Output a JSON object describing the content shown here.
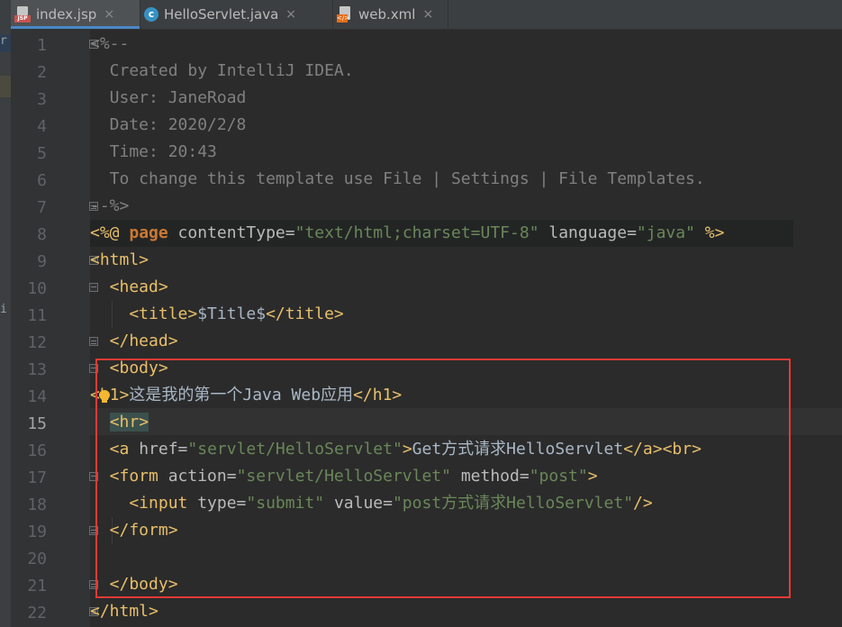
{
  "tabs": [
    {
      "label": "index.jsp",
      "icon": "jsp-file-icon",
      "active": true
    },
    {
      "label": "HelloServlet.java",
      "icon": "java-class-icon",
      "active": false
    },
    {
      "label": "web.xml",
      "icon": "xml-file-icon",
      "active": false
    }
  ],
  "tab_close_glyph": "×",
  "icon_labels": {
    "jsp": "JSP",
    "java": "c",
    "xml": "</>"
  },
  "left_panel_fragments": [
    "r",
    "i"
  ],
  "line_numbers": [
    "1",
    "2",
    "3",
    "4",
    "5",
    "6",
    "7",
    "8",
    "9",
    "10",
    "11",
    "12",
    "13",
    "14",
    "15",
    "16",
    "17",
    "18",
    "19",
    "20",
    "21",
    "22"
  ],
  "current_line": "15",
  "code": {
    "l1": "<%--",
    "l2": "  Created by IntelliJ IDEA.",
    "l3": "  User: JaneRoad",
    "l4": "  Date: 2020/2/8",
    "l5": "  Time: 20:43",
    "l6": "  To change this template use File | Settings | File Templates.",
    "l7": "--%>",
    "l8": {
      "open": "<%@ ",
      "directive": "page",
      "attr1": " contentType=",
      "val1": "\"text/html;charset=UTF-8\"",
      "attr2": " language=",
      "val2": "\"java\"",
      "close": " %>"
    },
    "l9": "<html>",
    "l10": "  <head>",
    "l11": {
      "open": "    <title>",
      "text": "$Title$",
      "close": "</title>"
    },
    "l12": "  </head>",
    "l13": "  <body>",
    "l14": {
      "open": "<h1>",
      "text": "这是我的第一个Java Web应用",
      "close": "</h1>"
    },
    "l15": "<hr>",
    "l16": {
      "open": "  <a",
      "attr": " href=",
      "val": "\"servlet/HelloServlet\"",
      "gt": ">",
      "text": "Get方式请求HelloServlet",
      "close": "</a><br>"
    },
    "l17": {
      "open": "  <form",
      "attr1": " action=",
      "val1": "\"servlet/HelloServlet\"",
      "attr2": " method=",
      "val2": "\"post\"",
      "gt": ">"
    },
    "l18": {
      "open": "    <input",
      "attr1": " type=",
      "val1": "\"submit\"",
      "attr2": " value=",
      "val2": "\"post方式请求HelloServlet\"",
      "close": "/>"
    },
    "l19": "  </form>",
    "l20": "",
    "l21": "  </body>",
    "l22": "</html>"
  },
  "colors": {
    "annotation_box": "#e53935",
    "tag": "#e8bf6a",
    "string": "#6a8759",
    "comment": "#808080",
    "keyword": "#cc7832"
  }
}
